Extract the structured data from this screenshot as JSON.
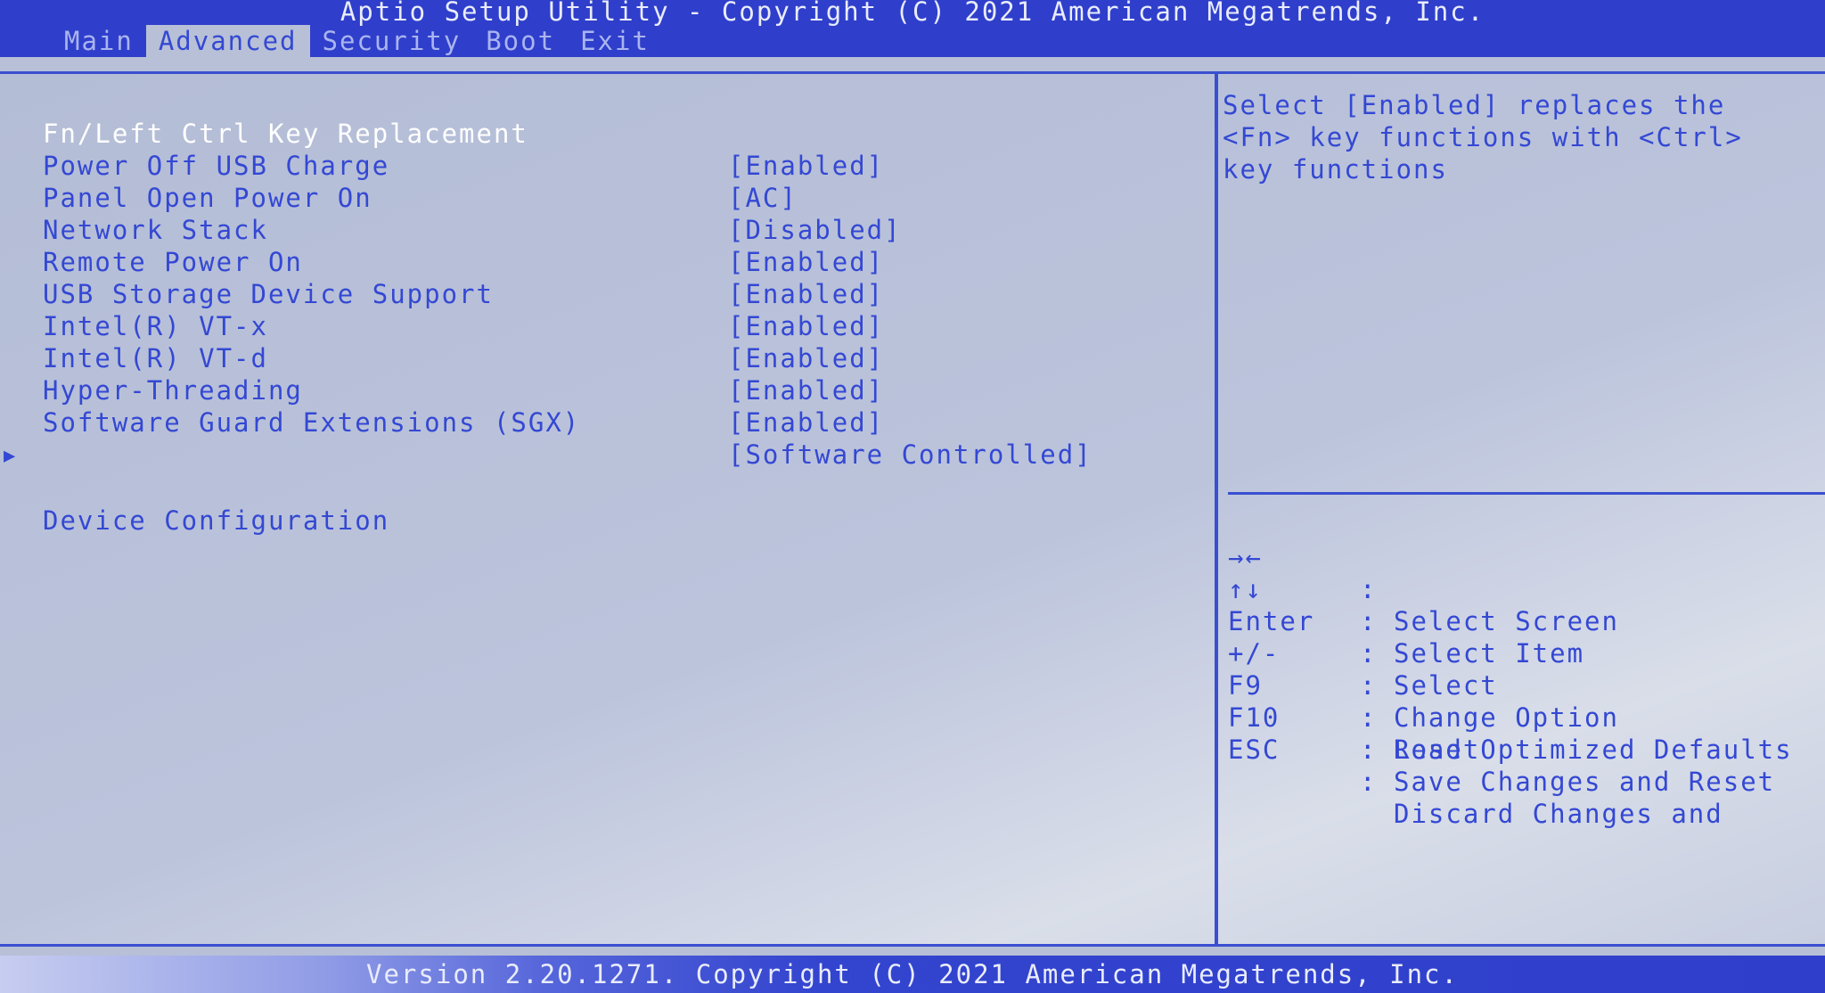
{
  "header": {
    "title": "Aptio Setup Utility - Copyright (C) 2021 American Megatrends, Inc."
  },
  "tabs": [
    {
      "label": "Main"
    },
    {
      "label": "Advanced"
    },
    {
      "label": "Security"
    },
    {
      "label": "Boot"
    },
    {
      "label": "Exit"
    }
  ],
  "settings": [
    {
      "label": "Fn/Left Ctrl Key Replacement",
      "value": "[Enabled]"
    },
    {
      "label": "Power Off USB Charge",
      "value": "[AC]"
    },
    {
      "label": "Panel Open Power On",
      "value": "[Disabled]"
    },
    {
      "label": "Network Stack",
      "value": "[Enabled]"
    },
    {
      "label": "Remote Power On",
      "value": "[Enabled]"
    },
    {
      "label": "USB Storage Device Support",
      "value": "[Enabled]"
    },
    {
      "label": "Intel(R) VT-x",
      "value": "[Enabled]"
    },
    {
      "label": "Intel(R) VT-d",
      "value": "[Enabled]"
    },
    {
      "label": "Hyper-Threading",
      "value": "[Enabled]"
    },
    {
      "label": "Software Guard Extensions (SGX)",
      "value": "[Software Controlled]"
    }
  ],
  "submenu": {
    "arrow": "▶",
    "label": "Device Configuration"
  },
  "help": {
    "text": "Select [Enabled] replaces the\n<Fn> key functions with <Ctrl>\nkey functions"
  },
  "keys": [
    {
      "key": "→←",
      "desc": "Select Screen"
    },
    {
      "key": "↑↓",
      "desc": "Select Item"
    },
    {
      "key": "Enter",
      "desc": "Select"
    },
    {
      "key": "+/-",
      "desc": "Change Option"
    },
    {
      "key": "F9",
      "desc": "Load Optimized Defaults"
    },
    {
      "key": "F10",
      "desc": "Save Changes and Reset"
    },
    {
      "key": "ESC",
      "desc": "Discard Changes and",
      "desc2": "Reset"
    }
  ],
  "key_separator": ":",
  "footer": {
    "text": "Version 2.20.1271. Copyright (C) 2021 American Megatrends, Inc."
  },
  "colors": {
    "accent": "#2f3fcb",
    "text": "#3448d3",
    "selected_text": "#ffffff",
    "background": "#b7c0d6"
  }
}
